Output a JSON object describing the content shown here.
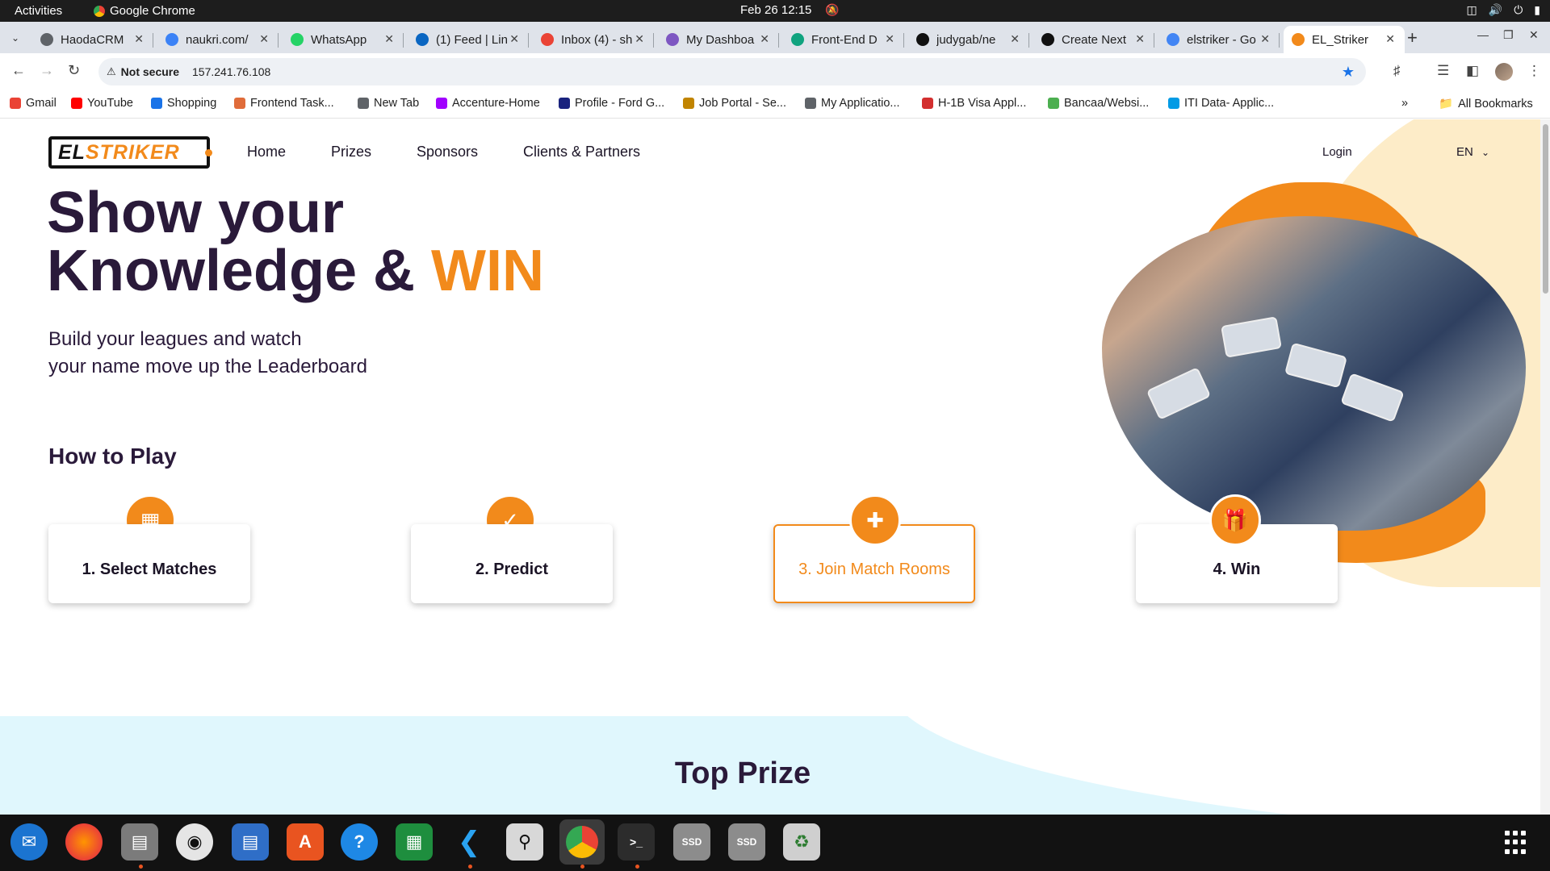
{
  "system": {
    "activities": "Activities",
    "app_name": "Google Chrome",
    "clock": "Feb 26  12:15"
  },
  "tabs": [
    {
      "title": "HaodaCRM",
      "color": "#5f6368"
    },
    {
      "title": "naukri.com/",
      "color": "#3b82f6"
    },
    {
      "title": "WhatsApp",
      "color": "#25d366"
    },
    {
      "title": "(1) Feed | Lin",
      "color": "#0a66c2"
    },
    {
      "title": "Inbox (4) - sh",
      "color": "#ea4335"
    },
    {
      "title": "My Dashboa",
      "color": "#7e57c2"
    },
    {
      "title": "Front-End D",
      "color": "#10a37f"
    },
    {
      "title": "judygab/ne",
      "color": "#111111"
    },
    {
      "title": "Create Next",
      "color": "#111111"
    },
    {
      "title": "elstriker - Go",
      "color": "#4285f4"
    },
    {
      "title": "EL_Striker",
      "color": "#f28a1b"
    }
  ],
  "toolbar": {
    "security": "Not secure",
    "url": "157.241.76.108"
  },
  "bookmarks": [
    {
      "label": "Gmail",
      "color": "#ea4335"
    },
    {
      "label": "YouTube",
      "color": "#ff0000"
    },
    {
      "label": "Shopping",
      "color": "#1a73e8"
    },
    {
      "label": "Frontend Task...",
      "color": "#e06c3a"
    },
    {
      "label": "New Tab",
      "color": "#5f6368"
    },
    {
      "label": "Accenture-Home",
      "color": "#a100ff"
    },
    {
      "label": "Profile - Ford G...",
      "color": "#1a237e"
    },
    {
      "label": "Job Portal - Se...",
      "color": "#c18400"
    },
    {
      "label": "My Applicatio...",
      "color": "#5f6368"
    },
    {
      "label": "H-1B Visa Appl...",
      "color": "#d32f2f"
    },
    {
      "label": "Bancaa/Websi...",
      "color": "#4caf50"
    },
    {
      "label": "ITI Data- Applic...",
      "color": "#039be5"
    }
  ],
  "bookmarks_more": "All Bookmarks",
  "site": {
    "logo_el": "EL",
    "logo_striker": "STRIKER",
    "nav": [
      "Home",
      "Prizes",
      "Sponsors",
      "Clients & Partners"
    ],
    "login": "Login",
    "language": "EN",
    "hero_line1": "Show your",
    "hero_line2": "Knowledge &",
    "hero_win": "WIN",
    "hero_sub_1": "Build your leagues and watch",
    "hero_sub_2": "your name move up the Leaderboard",
    "how_to_play": "How to Play",
    "steps": [
      {
        "label": "1. Select Matches",
        "icon": "shapes-icon"
      },
      {
        "label": "2. Predict",
        "icon": "check-circle-icon"
      },
      {
        "label": "3. Join Match Rooms",
        "icon": "user-plus-icon"
      },
      {
        "label": "4. Win",
        "icon": "gift-icon"
      }
    ],
    "top_prize": "Top Prize"
  },
  "colors": {
    "accent": "#f28a1b",
    "text_dark": "#2a1a3a",
    "prize_band": "#e0f7fd"
  }
}
